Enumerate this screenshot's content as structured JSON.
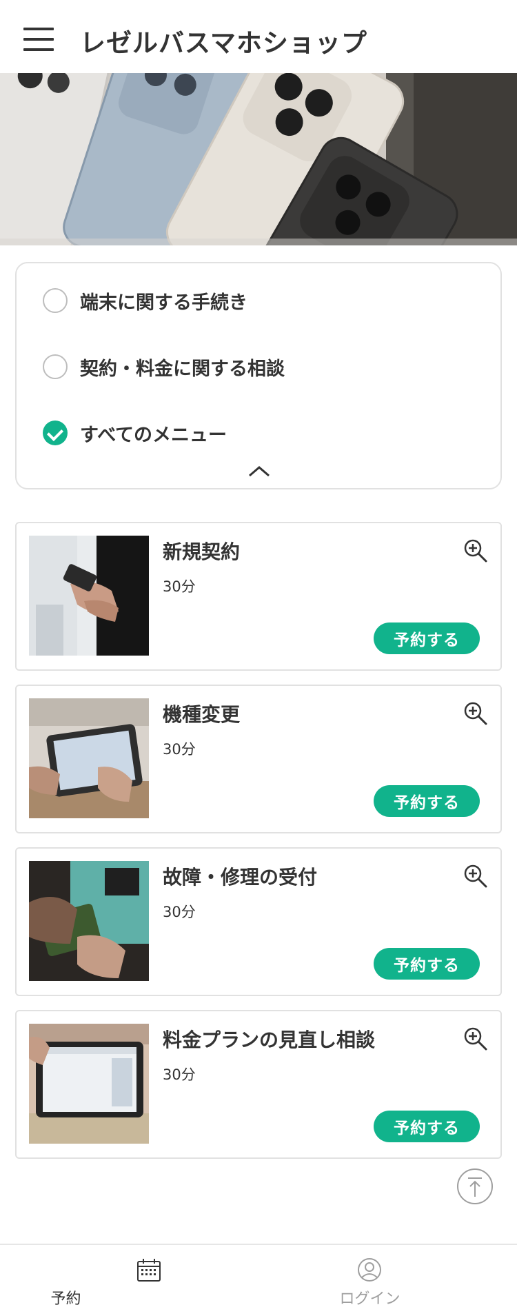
{
  "header": {
    "title": "レゼルバスマホショップ",
    "menu_icon": "hamburger-menu-icon"
  },
  "hero": {
    "alt": ""
  },
  "filter": {
    "options": [
      {
        "label": "端末に関する手続き",
        "selected": false
      },
      {
        "label": "契約・料金に関する相談",
        "selected": false
      },
      {
        "label": "すべてのメニュー",
        "selected": true
      }
    ],
    "collapse_icon": "chevron-up-icon"
  },
  "menus": [
    {
      "title": "新規契約",
      "duration": "30分",
      "button": "予約する"
    },
    {
      "title": "機種変更",
      "duration": "30分",
      "button": "予約する"
    },
    {
      "title": "故障・修理の受付",
      "duration": "30分",
      "button": "予約する"
    },
    {
      "title": "料金プランの見直し相談",
      "duration": "30分",
      "button": "予約する"
    }
  ],
  "nav": {
    "items": [
      {
        "label": "予約",
        "icon": "calendar-icon",
        "active": true
      },
      {
        "label": "ログイン",
        "icon": "user-icon",
        "active": false
      }
    ]
  },
  "colors": {
    "accent": "#11b38c",
    "text": "#333333",
    "muted": "#9e9e9e",
    "border": "#e1e1e1"
  }
}
